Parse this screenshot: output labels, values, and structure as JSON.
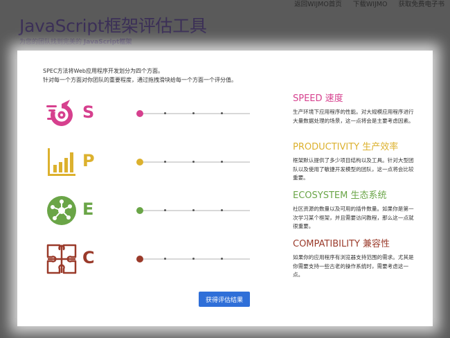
{
  "top_nav": [
    "返回WIJMO首页",
    "下载WIJMO",
    "获取免费电子书"
  ],
  "header": {
    "title": "JavaScript框架评估工具",
    "subtitle_prefix": "为您的团队找到完美的 ",
    "subtitle_bold": "JavaScript框架"
  },
  "intro": {
    "line1": "SPEC方法将Web应用程序开发划分为四个方面。",
    "line2": "针对每一个方面对你团队的重要程度，通过拖拽滑块给每一个方面一个评分值。"
  },
  "criteria": [
    {
      "letter": "S",
      "icon": "speed-icon",
      "color": "#d6408e",
      "slider_value": 0,
      "title": "SPEED 速度",
      "description": "生产环境下应用程序的性能。对大规模应用程序进行大量数据处理的场景，这一点将会是主要考虑因素。"
    },
    {
      "letter": "P",
      "icon": "bar-chart-icon",
      "color": "#dcb12e",
      "slider_value": 0,
      "title": "PRODUCTIVITY 生产效率",
      "description": "框架默认提供了多少项目结构以及工具。针对大型团队以及使用了敏捷开发模型的团队，这一点将会比较重要。"
    },
    {
      "letter": "E",
      "icon": "network-icon",
      "color": "#6aa547",
      "slider_value": 0,
      "title": "ECOSYSTEM 生态系统",
      "description": "社区资源的数量以及可用的插件数量。如果你是第一次学习某个框架，并且需要访问教程，那么这一点就很重要。"
    },
    {
      "letter": "C",
      "icon": "puzzle-icon",
      "color": "#9a3a2a",
      "slider_value": 0,
      "title": "COMPATIBILITY 兼容性",
      "description": "如果你的应用程序有浏览器支持范围的需求。尤其是你需要支持一些古老的操作系统时，需要考虑这一点。"
    }
  ],
  "submit_label": "获得评估结果"
}
